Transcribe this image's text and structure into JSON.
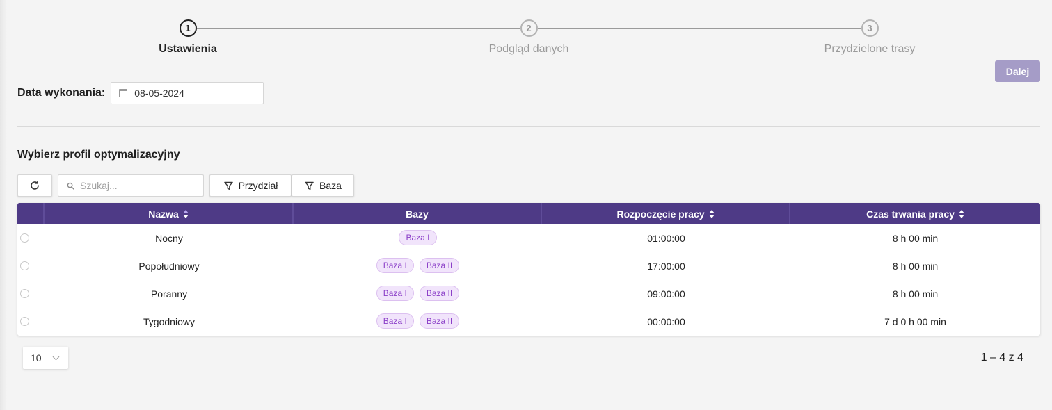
{
  "stepper": {
    "steps": [
      {
        "number": "1",
        "label": "Ustawienia",
        "active": true
      },
      {
        "number": "2",
        "label": "Podgląd danych",
        "active": false
      },
      {
        "number": "3",
        "label": "Przydzielone trasy",
        "active": false
      }
    ]
  },
  "next_button": "Dalej",
  "date": {
    "label": "Data wykonania:",
    "value": "08-05-2024"
  },
  "section_title": "Wybierz profil optymalizacyjny",
  "toolbar": {
    "search_placeholder": "Szukaj...",
    "filter_assignment": "Przydział",
    "filter_base": "Baza"
  },
  "table": {
    "headers": {
      "name": "Nazwa",
      "bases": "Bazy",
      "start": "Rozpoczęcie pracy",
      "duration": "Czas trwania pracy"
    },
    "rows": [
      {
        "name": "Nocny",
        "bases": [
          "Baza I"
        ],
        "start": "01:00:00",
        "duration": "8 h 00 min"
      },
      {
        "name": "Popołudniowy",
        "bases": [
          "Baza I",
          "Baza II"
        ],
        "start": "17:00:00",
        "duration": "8 h 00 min"
      },
      {
        "name": "Poranny",
        "bases": [
          "Baza I",
          "Baza II"
        ],
        "start": "09:00:00",
        "duration": "8 h 00 min"
      },
      {
        "name": "Tygodniowy",
        "bases": [
          "Baza I",
          "Baza II"
        ],
        "start": "00:00:00",
        "duration": "7 d 0 h 00 min"
      }
    ]
  },
  "pagination": {
    "page_size": "10",
    "range": "1 – 4 z 4"
  },
  "colors": {
    "header_bg": "#4e3a86",
    "accent_button": "#a59cc7",
    "badge_text": "#8b3fc8",
    "badge_bg": "#f1e4fb"
  }
}
